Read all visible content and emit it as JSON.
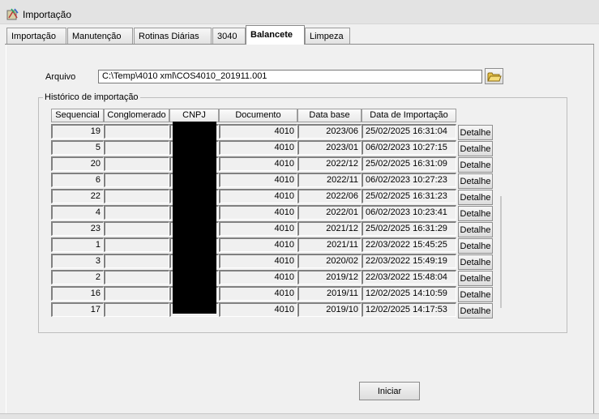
{
  "window": {
    "title": "Importação",
    "icon": "app-icon"
  },
  "tabs": [
    {
      "label": "Importação"
    },
    {
      "label": "Manutenção"
    },
    {
      "label": "Rotinas Diárias"
    },
    {
      "label": "3040"
    },
    {
      "label": "Balancete",
      "active": true
    },
    {
      "label": "Limpeza"
    }
  ],
  "arquivo": {
    "label": "Arquivo",
    "value": "C:\\Temp\\4010 xml\\COS4010_201911.001",
    "browse_icon": "folder-icon"
  },
  "historico": {
    "title": "Histórico de importação",
    "columns": [
      "Sequencial",
      "Conglomerado",
      "CNPJ",
      "Documento",
      "Data base",
      "Data de Importação"
    ],
    "detail_label": "Detalhe",
    "rows": [
      {
        "seq": "19",
        "conglomerado": "",
        "documento": "4010",
        "data_base": "2023/06",
        "data_importacao": "25/02/2025 16:31:04"
      },
      {
        "seq": "5",
        "conglomerado": "",
        "documento": "4010",
        "data_base": "2023/01",
        "data_importacao": "06/02/2023 10:27:15"
      },
      {
        "seq": "20",
        "conglomerado": "",
        "documento": "4010",
        "data_base": "2022/12",
        "data_importacao": "25/02/2025 16:31:09"
      },
      {
        "seq": "6",
        "conglomerado": "",
        "documento": "4010",
        "data_base": "2022/11",
        "data_importacao": "06/02/2023 10:27:23"
      },
      {
        "seq": "22",
        "conglomerado": "",
        "documento": "4010",
        "data_base": "2022/06",
        "data_importacao": "25/02/2025 16:31:23"
      },
      {
        "seq": "4",
        "conglomerado": "",
        "documento": "4010",
        "data_base": "2022/01",
        "data_importacao": "06/02/2023 10:23:41"
      },
      {
        "seq": "23",
        "conglomerado": "",
        "documento": "4010",
        "data_base": "2021/12",
        "data_importacao": "25/02/2025 16:31:29"
      },
      {
        "seq": "1",
        "conglomerado": "",
        "documento": "4010",
        "data_base": "2021/11",
        "data_importacao": "22/03/2022 15:45:25"
      },
      {
        "seq": "3",
        "conglomerado": "",
        "documento": "4010",
        "data_base": "2020/02",
        "data_importacao": "22/03/2022 15:49:19"
      },
      {
        "seq": "2",
        "conglomerado": "",
        "documento": "4010",
        "data_base": "2019/12",
        "data_importacao": "22/03/2022 15:48:04"
      },
      {
        "seq": "16",
        "conglomerado": "",
        "documento": "4010",
        "data_base": "2019/11",
        "data_importacao": "12/02/2025 14:10:59"
      },
      {
        "seq": "17",
        "conglomerado": "",
        "documento": "4010",
        "data_base": "2019/10",
        "data_importacao": "12/02/2025 14:17:53"
      }
    ]
  },
  "actions": {
    "start_label": "Iniciar"
  }
}
